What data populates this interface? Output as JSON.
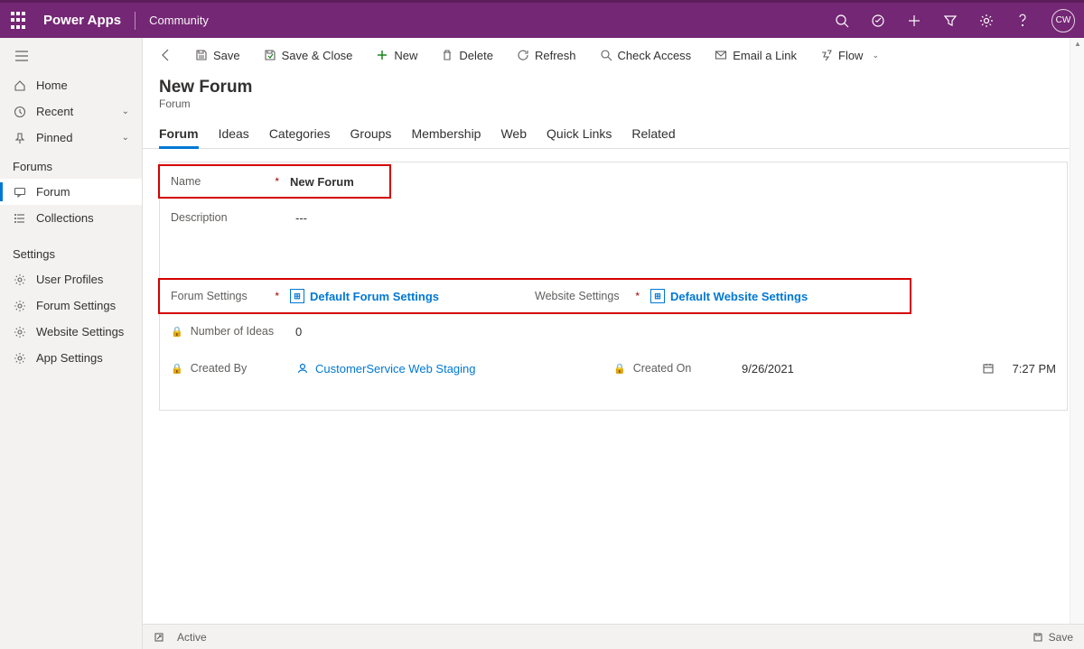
{
  "topbar": {
    "brand": "Power Apps",
    "env": "Community",
    "avatar": "CW"
  },
  "leftnav": {
    "home": "Home",
    "recent": "Recent",
    "pinned": "Pinned",
    "section_forums": "Forums",
    "forum": "Forum",
    "collections": "Collections",
    "section_settings": "Settings",
    "user_profiles": "User Profiles",
    "forum_settings": "Forum Settings",
    "website_settings": "Website Settings",
    "app_settings": "App Settings"
  },
  "cmd": {
    "save": "Save",
    "save_close": "Save & Close",
    "new": "New",
    "delete": "Delete",
    "refresh": "Refresh",
    "check_access": "Check Access",
    "email_link": "Email a Link",
    "flow": "Flow"
  },
  "page": {
    "title": "New Forum",
    "entity": "Forum"
  },
  "tabs": [
    "Forum",
    "Ideas",
    "Categories",
    "Groups",
    "Membership",
    "Web",
    "Quick Links",
    "Related"
  ],
  "form": {
    "name_label": "Name",
    "name_value": "New Forum",
    "desc_label": "Description",
    "desc_value": "---",
    "forum_settings_label": "Forum Settings",
    "forum_settings_value": "Default Forum Settings",
    "website_settings_label": "Website Settings",
    "website_settings_value": "Default Website Settings",
    "num_ideas_label": "Number of Ideas",
    "num_ideas_value": "0",
    "created_by_label": "Created By",
    "created_by_value": "CustomerService Web Staging",
    "created_on_label": "Created On",
    "created_on_date": "9/26/2021",
    "created_on_time": "7:27 PM"
  },
  "status": {
    "state": "Active",
    "save": "Save"
  }
}
